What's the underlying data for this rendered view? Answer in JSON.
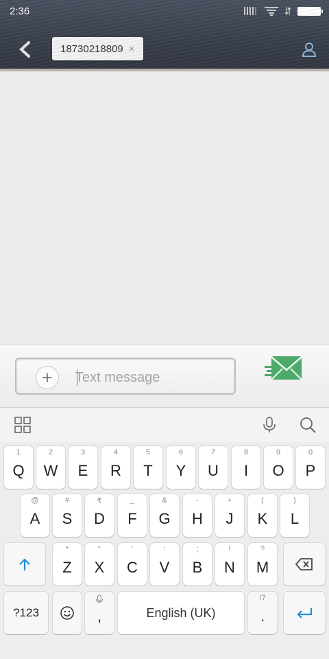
{
  "status_bar": {
    "time": "2:36"
  },
  "header": {
    "recipient": "18730218809",
    "chip_close": "×"
  },
  "compose": {
    "placeholder": "Text message",
    "add_label": "+"
  },
  "keyboard": {
    "row1": [
      {
        "hint": "1",
        "key": "Q"
      },
      {
        "hint": "2",
        "key": "W"
      },
      {
        "hint": "3",
        "key": "E"
      },
      {
        "hint": "4",
        "key": "R"
      },
      {
        "hint": "5",
        "key": "T"
      },
      {
        "hint": "6",
        "key": "Y"
      },
      {
        "hint": "7",
        "key": "U"
      },
      {
        "hint": "8",
        "key": "I"
      },
      {
        "hint": "9",
        "key": "O"
      },
      {
        "hint": "0",
        "key": "P"
      }
    ],
    "row2": [
      {
        "hint": "@",
        "key": "A"
      },
      {
        "hint": "#",
        "key": "S"
      },
      {
        "hint": "₹",
        "key": "D"
      },
      {
        "hint": "_",
        "key": "F"
      },
      {
        "hint": "&",
        "key": "G"
      },
      {
        "hint": "-",
        "key": "H"
      },
      {
        "hint": "+",
        "key": "J"
      },
      {
        "hint": "(",
        "key": "K"
      },
      {
        "hint": ")",
        "key": "L"
      }
    ],
    "row3": [
      {
        "hint": "*",
        "key": "Z"
      },
      {
        "hint": "\"",
        "key": "X"
      },
      {
        "hint": "'",
        "key": "C"
      },
      {
        "hint": ":",
        "key": "V"
      },
      {
        "hint": ";",
        "key": "B"
      },
      {
        "hint": "!",
        "key": "N"
      },
      {
        "hint": "?",
        "key": "M"
      }
    ],
    "symbols_label": "?123",
    "comma": ",",
    "space_label": "English (UK)",
    "period": ".",
    "period_hint": "!?"
  },
  "colors": {
    "accent": "#1d8fd8",
    "send_green": "#4daa6a"
  }
}
